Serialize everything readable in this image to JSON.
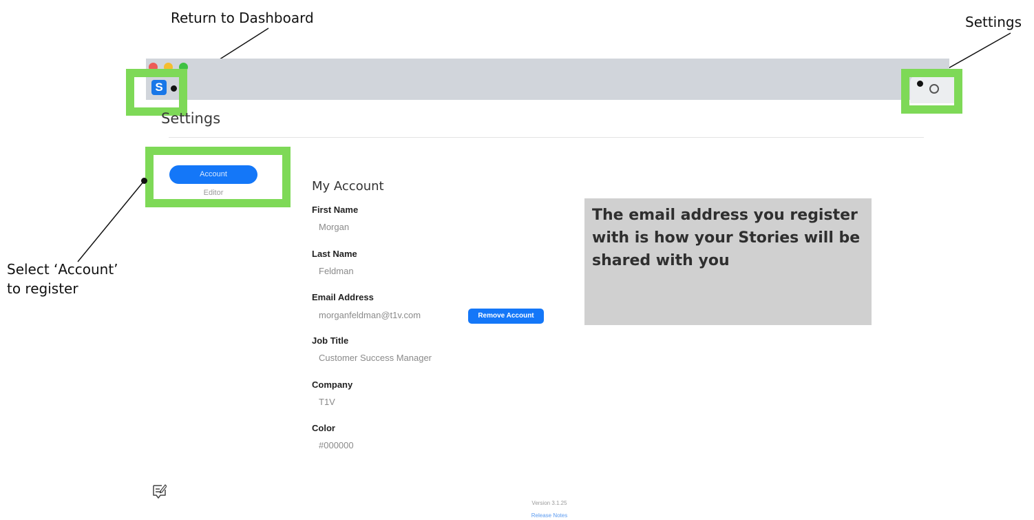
{
  "annotations": {
    "return_to_dashboard": "Return to Dashboard",
    "settings": "Settings",
    "select_account_line1": "Select ‘Account’",
    "select_account_line2": "to register",
    "info_box": "The email address you register with is how your Stories will be shared with you",
    "highlight_color": "#7ed957",
    "info_box_color": "#d0d0d0"
  },
  "window": {
    "logo_letter": "S",
    "logo_icon": "stories-logo-icon",
    "settings_icon": "gear-icon",
    "traffic_lights": [
      "#ed5b56",
      "#f5bd2f",
      "#3fc142"
    ],
    "titlebar_color": "#d1d5db"
  },
  "page": {
    "title": "Settings"
  },
  "nav": {
    "items": [
      {
        "label": "Account",
        "active": true
      },
      {
        "label": "Editor",
        "active": false
      }
    ],
    "accent": "#1477f8"
  },
  "account": {
    "heading": "My Account",
    "fields": [
      {
        "label": "First Name",
        "value": "Morgan"
      },
      {
        "label": "Last Name",
        "value": "Feldman"
      },
      {
        "label": "Email Address",
        "value": "morganfeldman@t1v.com"
      },
      {
        "label": "Job Title",
        "value": "Customer Success Manager"
      },
      {
        "label": "Company",
        "value": "T1V"
      },
      {
        "label": "Color",
        "value": "#000000"
      }
    ],
    "remove_button": "Remove Account"
  },
  "footer": {
    "feedback_icon": "feedback-icon",
    "version": "Version 3.1.25",
    "release_notes": "Release Notes"
  }
}
